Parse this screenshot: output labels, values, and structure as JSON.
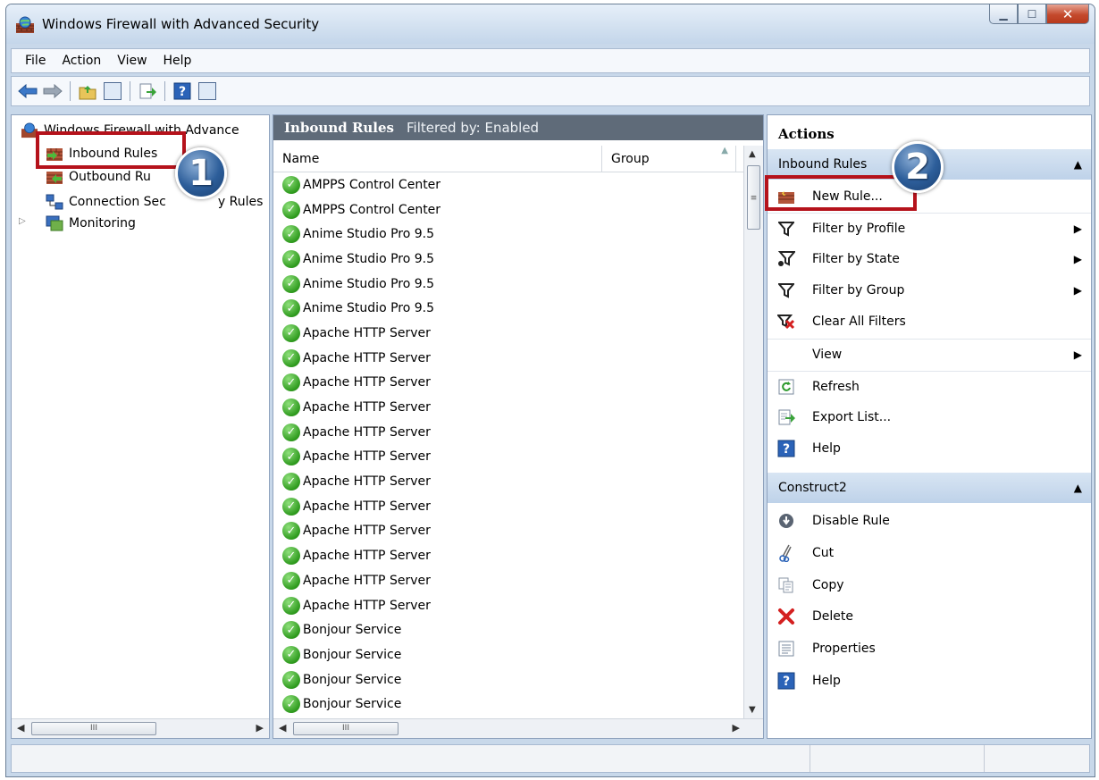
{
  "window": {
    "title": "Windows Firewall with Advanced Security"
  },
  "menu": [
    "File",
    "Action",
    "View",
    "Help"
  ],
  "tree": {
    "root": "Windows Firewall with Advance",
    "items": [
      "Inbound Rules",
      "Outbound Ru",
      "Connection Sec",
      "y Rules",
      "Monitoring"
    ]
  },
  "list": {
    "header_title": "Inbound Rules",
    "header_filter": "Filtered by: Enabled",
    "col_name": "Name",
    "col_group": "Group",
    "rows": [
      "AMPPS Control Center",
      "AMPPS Control Center",
      "Anime Studio Pro 9.5",
      "Anime Studio Pro 9.5",
      "Anime Studio Pro 9.5",
      "Anime Studio Pro 9.5",
      "Apache HTTP Server",
      "Apache HTTP Server",
      "Apache HTTP Server",
      "Apache HTTP Server",
      "Apache HTTP Server",
      "Apache HTTP Server",
      "Apache HTTP Server",
      "Apache HTTP Server",
      "Apache HTTP Server",
      "Apache HTTP Server",
      "Apache HTTP Server",
      "Apache HTTP Server",
      "Bonjour Service",
      "Bonjour Service",
      "Bonjour Service",
      "Bonjour Service"
    ]
  },
  "actions": {
    "title": "Actions",
    "section1": "Inbound Rules",
    "items1": [
      "New Rule...",
      "Filter by Profile",
      "Filter by State",
      "Filter by Group",
      "Clear All Filters",
      "View",
      "Refresh",
      "Export List...",
      "Help"
    ],
    "section2": "Construct2",
    "items2": [
      "Disable Rule",
      "Cut",
      "Copy",
      "Delete",
      "Properties",
      "Help"
    ]
  },
  "callouts": {
    "badge1": "1",
    "badge2": "2"
  },
  "colors": {
    "callout": "#b5121b",
    "header": "#5f6b79",
    "section": "#c8daed"
  }
}
